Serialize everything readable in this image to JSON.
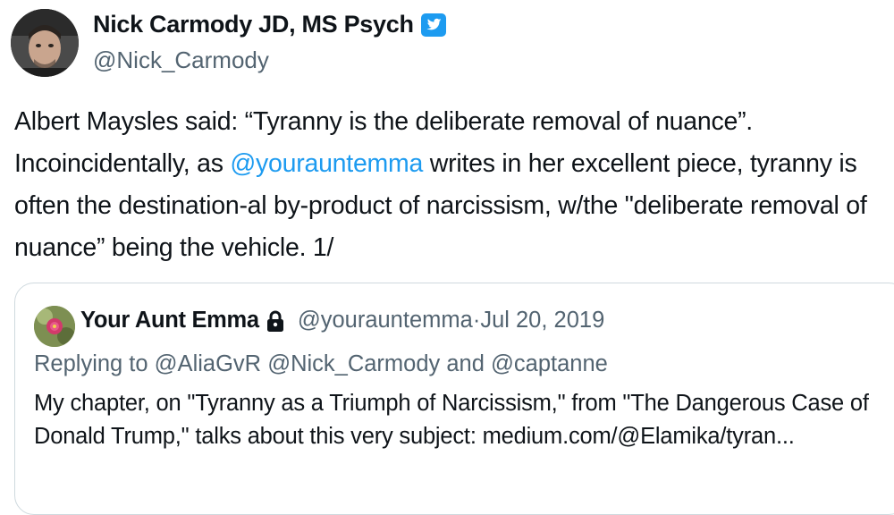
{
  "author": {
    "name": "Nick Carmody JD, MS Psych",
    "handle": "@Nick_Carmody",
    "verified_icon": "twitter-bird-verified-icon"
  },
  "tweet": {
    "part1": "Albert Maysles said: “Tyranny is the deliberate removal of nuance”. Incoincidentally, as ",
    "mention": "@yourauntemma",
    "part2": " writes in her excellent piece, tyranny is often the destination-al by-product of narcissism, w/the \"deliberate removal of nuance” being the vehicle. 1/"
  },
  "quote": {
    "name": "Your Aunt Emma",
    "lock_icon": "lock-icon",
    "handle": "@yourauntemma",
    "separator": " · ",
    "date": "Jul 20, 2019",
    "replying_prefix": "Replying to ",
    "reply_mention_1": "@AliaGvR",
    "reply_mention_2": "@Nick_Carmody",
    "reply_and": " and ",
    "reply_mention_3": "@captanne",
    "text": "My chapter, on \"Tyranny as a Triumph of Narcissism,\" from \"The Dangerous Case of Donald Trump,\" talks about this very subject: medium.com/@Elamika/tyran..."
  },
  "colors": {
    "link": "#1d9bf0",
    "secondary_text": "#536471",
    "primary_text": "#0f1419",
    "border": "#cfd9de"
  }
}
